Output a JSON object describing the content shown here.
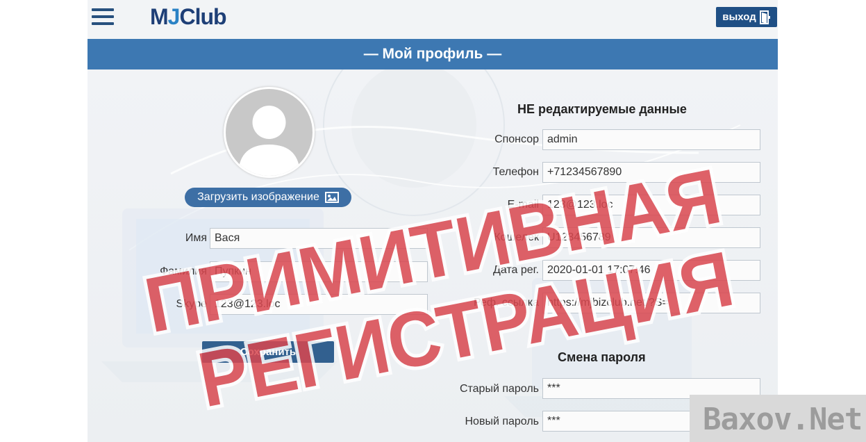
{
  "header": {
    "logo": {
      "m": "M",
      "j": "J",
      "club": "Club"
    },
    "logout_label": "выход",
    "menu_icon": "hamburger-icon",
    "logout_icon": "door-exit-icon"
  },
  "page_title": "— Мой профиль —",
  "profile": {
    "avatar_icon": "user-silhouette-icon",
    "upload_label": "Загрузить изображение",
    "upload_icon": "image-icon",
    "fields": [
      {
        "label": "Имя",
        "value": "Вася"
      },
      {
        "label": "Фамилия",
        "value": "Пупкин"
      },
      {
        "label": "Skype",
        "value": "123@123.loc"
      }
    ],
    "save_label": "Сохранить"
  },
  "readonly": {
    "title": "НЕ редактируемые данные",
    "fields": [
      {
        "label": "Спонсор",
        "value": "admin"
      },
      {
        "label": "Телефон",
        "value": "+71234567890"
      },
      {
        "label": "E-mail",
        "value": "123@123.loc"
      },
      {
        "label": "Кошелек",
        "value": "U123456789"
      },
      {
        "label": "Дата рег.",
        "value": "2020-01-01 17:07:46"
      },
      {
        "label": "Реф. ссылка",
        "value": "https://mjbizclub.net/?S="
      }
    ]
  },
  "password": {
    "title": "Смена пароля",
    "fields": [
      {
        "label": "Старый пароль",
        "value": "***"
      },
      {
        "label": "Новый пароль",
        "value": "***"
      }
    ]
  },
  "overlay": {
    "stamp_line1": "ПРИМИТИВНАЯ",
    "stamp_line2": "РЕГИСТРАЦИЯ",
    "watermark": "Baxov.Net"
  },
  "colors": {
    "accent": "#3d78b2",
    "dark_blue": "#1f4f85",
    "stamp_red": "#d9474f"
  }
}
